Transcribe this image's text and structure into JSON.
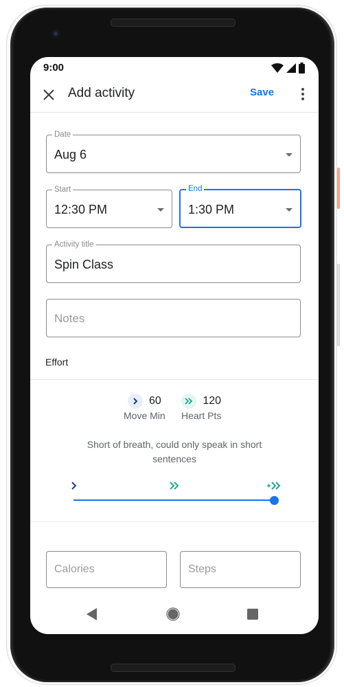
{
  "status_bar": {
    "time": "9:00",
    "icons": [
      "wifi-icon",
      "cellular-signal-icon",
      "battery-icon"
    ]
  },
  "app_bar": {
    "close_icon": "close-icon",
    "title": "Add activity",
    "save_label": "Save",
    "more_icon": "more-vert-icon"
  },
  "form": {
    "date": {
      "label": "Date",
      "value": "Aug 6"
    },
    "start": {
      "label": "Start",
      "value": "12:30 PM"
    },
    "end": {
      "label": "End",
      "value": "1:30 PM"
    },
    "activity_title": {
      "label": "Activity title",
      "value": "Spin Class"
    },
    "notes": {
      "placeholder": "Notes",
      "value": ""
    },
    "calories": {
      "placeholder": "Calories",
      "value": ""
    },
    "steps": {
      "placeholder": "Steps",
      "value": ""
    }
  },
  "effort": {
    "label": "Effort",
    "move_min": {
      "value": "60",
      "label": "Move Min"
    },
    "heart_pts": {
      "value": "120",
      "label": "Heart Pts"
    },
    "description": "Short of breath, could only speak in short sentences",
    "slider": {
      "levels": [
        "light-intensity-icon",
        "moderate-intensity-icon",
        "vigorous-intensity-icon"
      ],
      "value_fraction": 1.0
    }
  },
  "colors": {
    "accent": "#1a73e8",
    "move_min": "#1a3d8f",
    "heart_pts": "#1aaa8a",
    "move_min_bg": "#e8eef7",
    "heart_pts_bg": "#e3f6f1"
  },
  "nav_bar": {
    "buttons": [
      "back-icon",
      "home-icon",
      "recents-icon"
    ]
  }
}
